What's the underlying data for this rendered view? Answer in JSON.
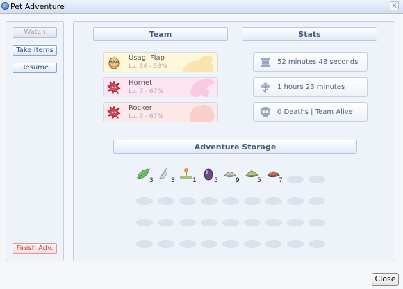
{
  "window": {
    "title": "Pet Adventure",
    "close_label": "Close"
  },
  "sidebar": {
    "watch": "Watch",
    "take_items": "Take Items",
    "resume": "Resume",
    "finish": "Finish Adv."
  },
  "team": {
    "header": "Team",
    "pets": [
      {
        "name": "Usagi Flap",
        "level": "Lv. 34 - 53%",
        "icon": "egg-icon",
        "bg": "#fff7d9"
      },
      {
        "name": "Hornet",
        "level": "Lv. 7 - 67%",
        "icon": "spiky-red-pet-icon",
        "bg": "#fde6f1"
      },
      {
        "name": "Rocker",
        "level": "Lv. 7 - 67%",
        "icon": "spiky-red-pet-icon",
        "bg": "#fde8e8"
      }
    ]
  },
  "stats": {
    "header": "Stats",
    "duration": "52 minutes 48 seconds",
    "remaining": "1 hours 23 minutes",
    "status": "0 Deaths | Team Alive"
  },
  "storage": {
    "header": "Adventure Storage",
    "items": [
      {
        "icon": "green-leaf-icon",
        "count": "3"
      },
      {
        "icon": "feather-icon",
        "count": "3"
      },
      {
        "icon": "flower-icon",
        "count": "1"
      },
      {
        "icon": "purple-gem-icon",
        "count": "5"
      },
      {
        "icon": "shell-icon",
        "count": "9"
      },
      {
        "icon": "green-shell-icon",
        "count": "5"
      },
      {
        "icon": "red-shell-icon",
        "count": "7"
      }
    ]
  }
}
